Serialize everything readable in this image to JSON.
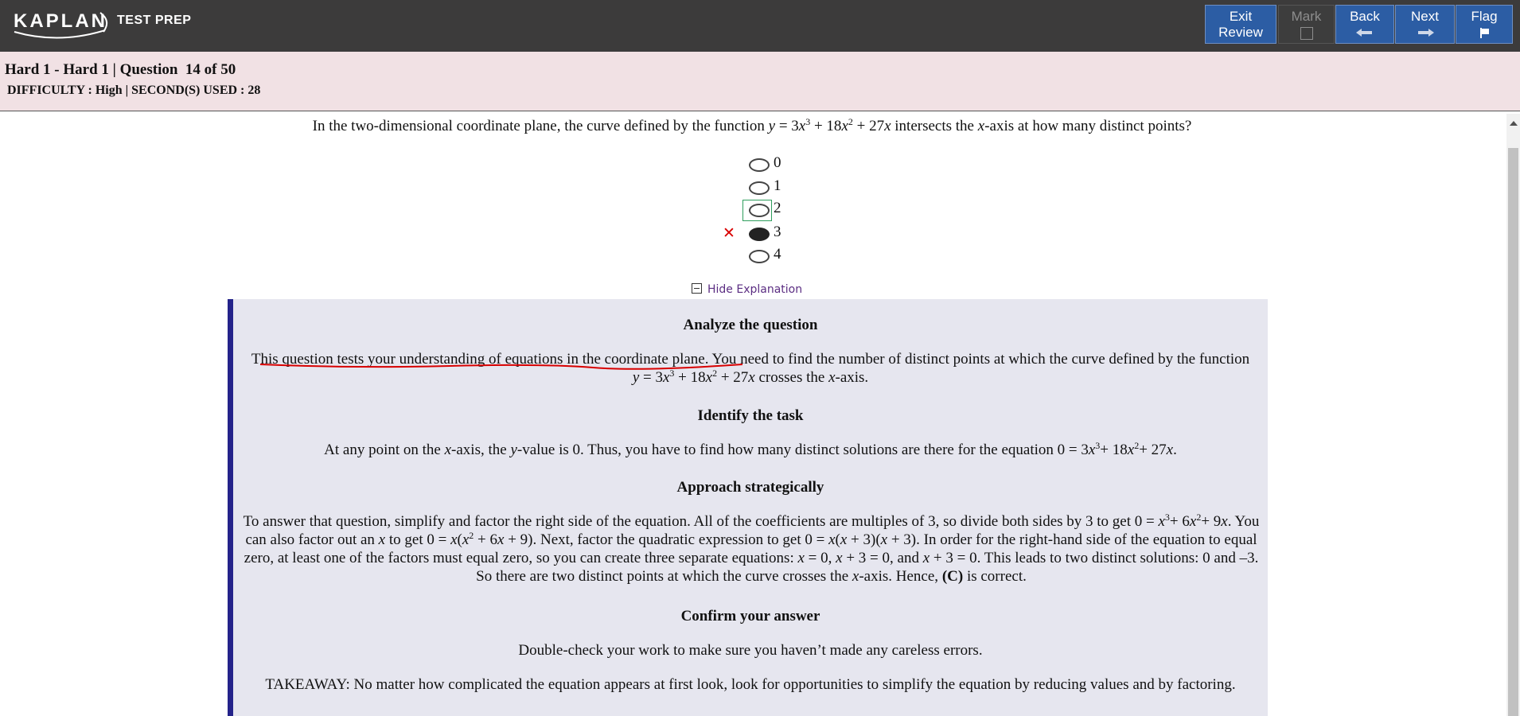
{
  "app": {
    "brand": "KAPLAN",
    "brand_sub": "TEST PREP"
  },
  "toolbar": {
    "exit_line1": "Exit",
    "exit_line2": "Review",
    "mark_label": "Mark",
    "back_label": "Back",
    "next_label": "Next",
    "flag_label": "Flag"
  },
  "header": {
    "title": "Hard 1 - Hard 1 | Question  14 of 50",
    "meta": "DIFFICULTY : High | SECOND(S) USED : 28"
  },
  "question": {
    "text": "In the two-dimensional coordinate plane, the curve defined by the function y = 3x3 + 18x2 + 27x intersects the x-axis at how many distinct points?"
  },
  "choices": [
    {
      "label": "0",
      "selected": false,
      "focused": false,
      "incorrect": false
    },
    {
      "label": "1",
      "selected": false,
      "focused": false,
      "incorrect": false
    },
    {
      "label": "2",
      "selected": false,
      "focused": true,
      "incorrect": false
    },
    {
      "label": "3",
      "selected": true,
      "focused": false,
      "incorrect": true
    },
    {
      "label": "4",
      "selected": false,
      "focused": false,
      "incorrect": false
    }
  ],
  "incorrect_marker": "✕",
  "explanation": {
    "toggle_label": "Hide Explanation",
    "h1": "Analyze the question",
    "p1_underlined": "This question tests your understanding of equations in the coordinate plane.",
    "p1_rest": " You need to find the number of distinct points at which the curve defined by the function y = 3x3 + 18x2 + 27x crosses the x-axis.",
    "h2": "Identify the task",
    "p2": "At any point on the x-axis, the y-value is 0. Thus, you have to find how many distinct solutions are there for the equation 0 = 3x3+ 18x2+ 27x.",
    "h3": "Approach strategically",
    "p3": "To answer that question, simplify and factor the right side of the equation. All of the coefficients are multiples of 3, so divide both sides by 3 to get 0 = x3+ 6x2+ 9x. You can also factor out an x to get 0 = x(x2 + 6x + 9). Next, factor the quadratic expression to get 0 = x(x + 3)(x + 3). In order for the right-hand side of the equation to equal zero, at least one of the factors must equal zero, so you can create three separate equations: x = 0, x + 3 = 0, and x + 3 = 0. This leads to two distinct solutions: 0 and –3. So there are two distinct points at which the curve crosses the x-axis. Hence, (C) is correct.",
    "h4": "Confirm your answer",
    "p4": "Double-check your work to make sure you haven’t made any careless errors.",
    "p5": "TAKEAWAY: No matter how complicated the equation appears at first look, look for opportunities to simplify the equation by reducing values and by factoring."
  },
  "colors": {
    "topbar": "#3c3b3b",
    "button_blue": "#2c5da4",
    "header_band": "#f1e1e4",
    "explanation_bg": "#e6e6ef",
    "explanation_border": "#24238a",
    "incorrect_red": "#d80000",
    "focus_green": "#2f9e5d",
    "link_purple": "#5b2d82"
  }
}
